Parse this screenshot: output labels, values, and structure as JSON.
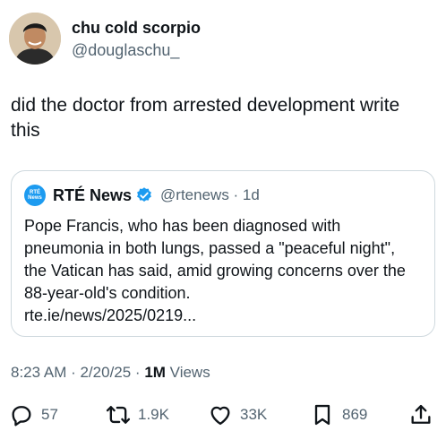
{
  "author": {
    "display_name": "chu cold scorpio",
    "handle": "@douglaschu_"
  },
  "tweet": {
    "text": "did the doctor from arrested development write this"
  },
  "quote": {
    "avatar_text_1": "RTÉ",
    "avatar_text_2": "News",
    "name": "RTÉ News",
    "handle_time": "@rtenews · 1d",
    "text": "Pope Francis, who has been diagnosed with pneumonia in both lungs, passed a \"peaceful night\", the Vatican has said, amid growing concerns over the 88-year-old's condition.",
    "link": "rte.ie/news/2025/0219..."
  },
  "meta": {
    "time_date": "8:23 AM · 2/20/25 · ",
    "views_count": "1M",
    "views_label": " Views"
  },
  "actions": {
    "replies": "57",
    "retweets": "1.9K",
    "likes": "33K",
    "bookmarks": "869"
  },
  "colors": {
    "text": "#0f1419",
    "secondary": "#536471",
    "border": "#cfd9de",
    "verified": "#1d9bf0"
  }
}
